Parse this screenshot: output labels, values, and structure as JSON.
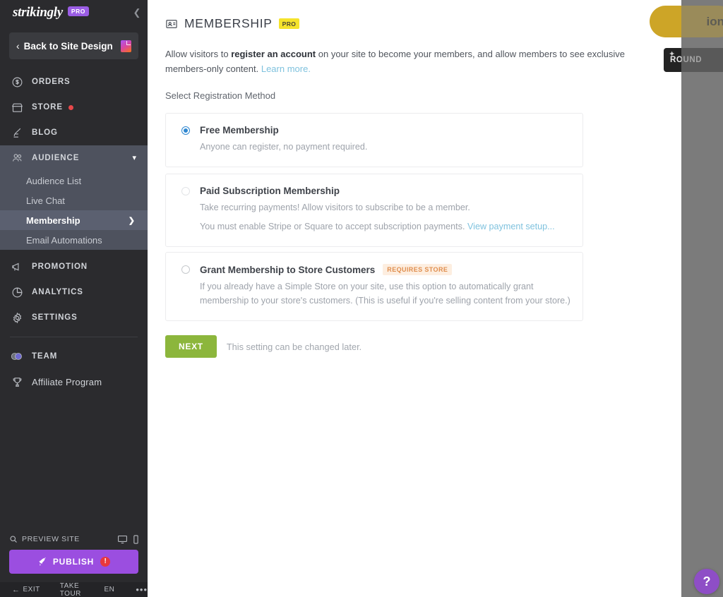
{
  "sidebar": {
    "brand": {
      "name": "strikingly",
      "badge": "PRO"
    },
    "collapse_icon": "chevron-left-icon",
    "back_button": {
      "label": "Back to Site Design",
      "chevron": "‹"
    },
    "nav": [
      {
        "label": "ORDERS",
        "icon": "dollar-circle-icon"
      },
      {
        "label": "STORE",
        "icon": "store-icon",
        "dot": true
      },
      {
        "label": "BLOG",
        "icon": "pen-icon"
      },
      {
        "label": "AUDIENCE",
        "icon": "people-icon",
        "expanded": true
      }
    ],
    "audience_sub": [
      {
        "label": "Audience List",
        "active": false
      },
      {
        "label": "Live Chat",
        "active": false
      },
      {
        "label": "Membership",
        "active": true
      },
      {
        "label": "Email Automations",
        "active": false
      }
    ],
    "nav_lower": [
      {
        "label": "PROMOTION",
        "icon": "megaphone-icon"
      },
      {
        "label": "ANALYTICS",
        "icon": "pie-chart-icon"
      },
      {
        "label": "SETTINGS",
        "icon": "gear-icon"
      }
    ],
    "nav_bottom": [
      {
        "label": "TEAM",
        "icon": "team-avatars-icon",
        "uppercase": true
      },
      {
        "label": "Affiliate Program",
        "icon": "trophy-icon",
        "uppercase": false
      }
    ],
    "preview": {
      "label": "PREVIEW SITE",
      "icon": "search-icon",
      "desktop_icon": "monitor-icon",
      "mobile_icon": "phone-icon"
    },
    "publish": {
      "label": "PUBLISH",
      "icon": "rocket-icon",
      "alert": "!"
    },
    "footer": {
      "exit": "EXIT",
      "take_tour": "TAKE TOUR",
      "lang": "EN",
      "more": "•••"
    }
  },
  "main": {
    "header": {
      "icon": "membership-card-icon",
      "title": "MEMBERSHIP",
      "badge": "PRO"
    },
    "description": {
      "part1": "Allow visitors to ",
      "bold": "register an account",
      "part2": " on your site to become your members, and allow members to see exclusive members-only content. ",
      "link": "Learn more."
    },
    "select_label": "Select Registration Method",
    "options": [
      {
        "title": "Free Membership",
        "selected": true,
        "desc": "Anyone can register, no payment required.",
        "desc2": "",
        "link": "",
        "badge": ""
      },
      {
        "title": "Paid Subscription Membership",
        "selected": false,
        "desc": "Take recurring payments! Allow visitors to subscribe to be a member.",
        "desc2": "You must enable Stripe or Square to accept subscription payments. ",
        "link": "View payment setup...",
        "badge": ""
      },
      {
        "title": "Grant Membership to Store Customers",
        "selected": false,
        "desc": "If you already have a Simple Store on your site, use this option to automatically grant membership to your store's customers. (This is useful if you're selling content from your store.)",
        "desc2": "",
        "link": "",
        "badge": "REQUIRES STORE"
      }
    ],
    "next_button": "NEXT",
    "next_note": "This setting can be changed later."
  },
  "overlay": {
    "gold_button_partial": "ion",
    "dark_button_partial": "ROUND",
    "help_icon": "?"
  },
  "colors": {
    "sidebar_bg": "#2b2b2e",
    "audience_bg": "#4e525e",
    "active_sub_bg": "#5b6070",
    "brand_pro": "#9b5de5",
    "publish": "#9b4ee0",
    "next_green": "#8cb63c",
    "pro_badge_yellow": "#f5e32b",
    "store_badge_bg": "#fdeee0",
    "store_badge_text": "#e08e4e",
    "link_blue": "#7fc2de",
    "radio_blue": "#2f87d0",
    "red_dot": "#e8484a",
    "help_purple": "#8e4ec6"
  }
}
